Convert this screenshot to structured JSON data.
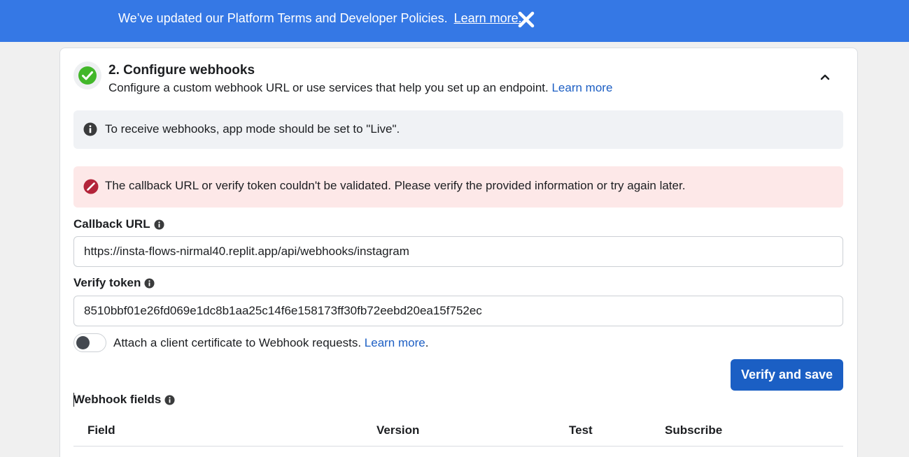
{
  "banner": {
    "message": "We’ve updated our Platform Terms and Developer Policies.",
    "link_label": "Learn more.",
    "close_icon": "close-icon",
    "bg_color": "#3578e5"
  },
  "step": {
    "title": "2. Configure webhooks",
    "subtitle": "Configure a custom webhook URL or use services that help you set up an endpoint.",
    "subtitle_link": "Learn more",
    "status_icon": "check-circle-icon",
    "status_color": "#42b72a",
    "collapse_icon": "chevron-up-icon"
  },
  "info_notice": {
    "icon": "info-icon",
    "text": "To receive webhooks, app mode should be set to \"Live\"."
  },
  "error_notice": {
    "icon": "error-icon",
    "text": "The callback URL or verify token couldn't be validated. Please verify the provided information or try again later.",
    "color": "#b3243a"
  },
  "callback_url": {
    "label": "Callback URL",
    "value": "https://insta-flows-nirmal40.replit.app/api/webhooks/instagram"
  },
  "verify_token": {
    "label": "Verify token",
    "value": "8510bbf01e26fd069e1dc8b1aa25c14f6e158173ff30fb72eebd20ea15f752ec"
  },
  "client_cert": {
    "label": "Attach a client certificate to Webhook requests.",
    "link": "Learn more",
    "trailing": ".",
    "enabled": false
  },
  "verify_button": "Verify and save",
  "webhook_fields": {
    "label": "Webhook fields",
    "columns": [
      "Field",
      "Version",
      "Test",
      "Subscribe"
    ]
  },
  "accent_color": "#1b5fc4"
}
